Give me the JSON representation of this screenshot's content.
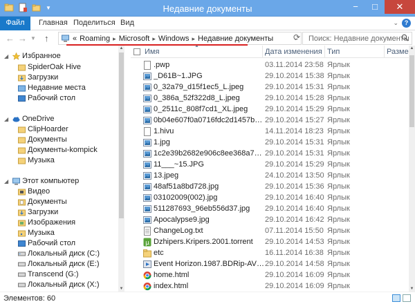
{
  "window": {
    "title": "Недавние документы",
    "controls": {
      "minimize": "−",
      "maximize": "□",
      "close": "✕"
    }
  },
  "ribbon": {
    "tabs": [
      "Файл",
      "Главная",
      "Поделиться",
      "Вид"
    ],
    "help": "?"
  },
  "address": {
    "prefix": "«",
    "crumbs": [
      "Roaming",
      "Microsoft",
      "Windows",
      "Недавние документы"
    ],
    "search_placeholder": "Поиск: Недавние документы"
  },
  "nav": {
    "favorites": {
      "label": "Избранное",
      "items": [
        "SpiderOak Hive",
        "Загрузки",
        "Недавние места",
        "Рабочий стол"
      ]
    },
    "onedrive": {
      "label": "OneDrive",
      "items": [
        "ClipHoarder",
        "Документы",
        "Документы-kompick",
        "Музыка"
      ]
    },
    "computer": {
      "label": "Этот компьютер",
      "items": [
        "Видео",
        "Документы",
        "Загрузки",
        "Изображения",
        "Музыка",
        "Рабочий стол",
        "Локальный диск (C:)",
        "Локальный диск (E:)",
        "Transcend (G:)",
        "Локальный диск (X:)"
      ]
    }
  },
  "columns": {
    "name": "Имя",
    "date": "Дата изменения",
    "type": "Тип",
    "size": "Разме"
  },
  "files": [
    {
      "name": ".pwp",
      "date": "03.11.2014 23:58",
      "type": "Ярлык",
      "icon": "doc-icon"
    },
    {
      "name": "_D61B~1.JPG",
      "date": "29.10.2014 15:38",
      "type": "Ярлык",
      "icon": "image-icon"
    },
    {
      "name": "0_32a79_d15f1ec5_L.jpeg",
      "date": "29.10.2014 15:31",
      "type": "Ярлык",
      "icon": "image-icon"
    },
    {
      "name": "0_386a_52f322d8_L.jpeg",
      "date": "29.10.2014 15:28",
      "type": "Ярлык",
      "icon": "image-icon"
    },
    {
      "name": "0_2511c_808f7cd1_XL.jpeg",
      "date": "29.10.2014 15:29",
      "type": "Ярлык",
      "icon": "image-icon"
    },
    {
      "name": "0b04e607f0a0716fdc2d1457b2c28d63.j...",
      "date": "29.10.2014 15:27",
      "type": "Ярлык",
      "icon": "image-icon"
    },
    {
      "name": "1.hivu",
      "date": "14.11.2014 18:23",
      "type": "Ярлык",
      "icon": "doc-icon"
    },
    {
      "name": "1.jpg",
      "date": "29.10.2014 15:31",
      "type": "Ярлык",
      "icon": "image-icon"
    },
    {
      "name": "1c2e39b2682e906c8ee368a7d84a235f_f...",
      "date": "29.10.2014 15:31",
      "type": "Ярлык",
      "icon": "image-icon"
    },
    {
      "name": "11___~15.JPG",
      "date": "29.10.2014 15:29",
      "type": "Ярлык",
      "icon": "image-icon"
    },
    {
      "name": "13.jpeg",
      "date": "24.10.2014 13:50",
      "type": "Ярлык",
      "icon": "image-icon"
    },
    {
      "name": "48af51a8bd728.jpg",
      "date": "29.10.2014 15:36",
      "type": "Ярлык",
      "icon": "image-icon"
    },
    {
      "name": "03102009(002).jpg",
      "date": "29.10.2014 16:40",
      "type": "Ярлык",
      "icon": "image-icon"
    },
    {
      "name": "511287693_96eb556d37.jpg",
      "date": "29.10.2014 16:40",
      "type": "Ярлык",
      "icon": "image-icon"
    },
    {
      "name": "Apocalypse9.jpg",
      "date": "29.10.2014 16:42",
      "type": "Ярлык",
      "icon": "image-icon"
    },
    {
      "name": "ChangeLog.txt",
      "date": "07.11.2014 15:50",
      "type": "Ярлык",
      "icon": "text-icon"
    },
    {
      "name": "Dzhipers.Kripers.2001.torrent",
      "date": "29.10.2014 14:53",
      "type": "Ярлык",
      "icon": "torrent-icon"
    },
    {
      "name": "etc",
      "date": "16.11.2014 16:38",
      "type": "Ярлык",
      "icon": "folder-icon"
    },
    {
      "name": "Event Horizon.1987.BDRip-AVC.PT.mk...",
      "date": "29.10.2014 14:58",
      "type": "Ярлык",
      "icon": "video-icon"
    },
    {
      "name": "home.html",
      "date": "29.10.2014 16:09",
      "type": "Ярлык",
      "icon": "chrome-icon"
    },
    {
      "name": "index.html",
      "date": "29.10.2014 16:09",
      "type": "Ярлык",
      "icon": "chrome-icon"
    }
  ],
  "status": {
    "count": "Элементов: 60"
  },
  "colors": {
    "titlebar": "#6aa7e8",
    "file_tab": "#1979ca",
    "highlight": "#d82020",
    "folder": "#e8c25a"
  }
}
